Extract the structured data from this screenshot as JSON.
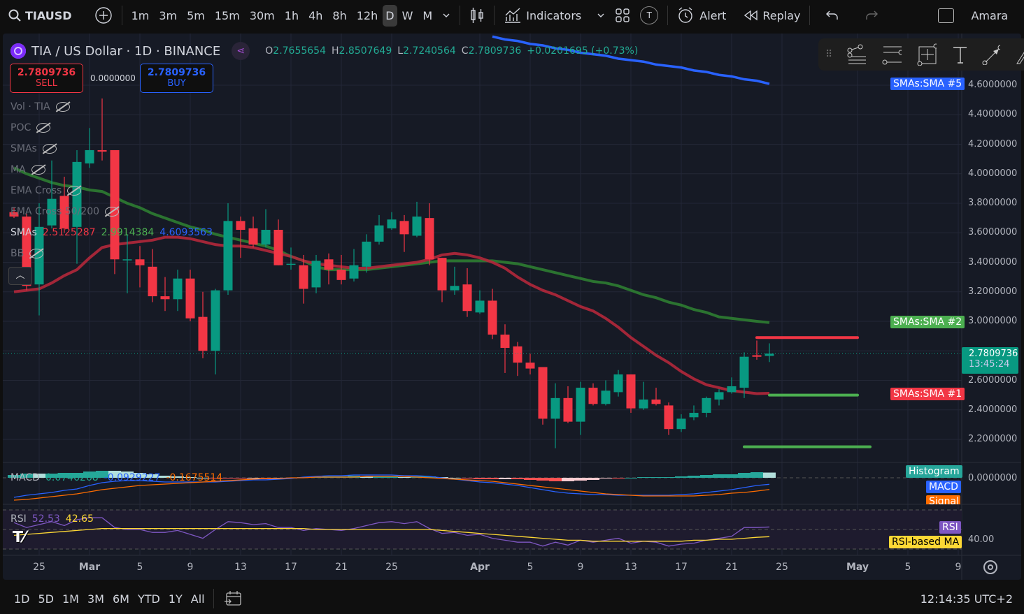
{
  "topbar": {
    "symbol": "TIAUSD",
    "intervals": [
      "1m",
      "3m",
      "5m",
      "15m",
      "30m",
      "1h",
      "4h",
      "8h",
      "12h",
      "D",
      "W",
      "M"
    ],
    "active_interval": "D",
    "indicators": "Indicators",
    "alert": "Alert",
    "replay": "Replay",
    "user": "Amara",
    "t_badge": "T"
  },
  "header": {
    "title": "TIA / US Dollar · 1D · BINANCE",
    "o_label": "O",
    "o": "2.7655654",
    "h_label": "H",
    "h": "2.8507649",
    "l_label": "L",
    "l": "2.7240564",
    "c_label": "C",
    "c": "2.7809736",
    "change": "+0.0201695 (+0.73%)"
  },
  "trade": {
    "sell_price": "2.7809736",
    "sell_label": "SELL",
    "spread": "0.0000000",
    "buy_price": "2.7809736",
    "buy_label": "BUY"
  },
  "legend": [
    {
      "name": "Vol · TIA"
    },
    {
      "name": "POC"
    },
    {
      "name": "SMAs"
    },
    {
      "name": "MA"
    },
    {
      "name": "EMA Cross"
    },
    {
      "name": "EMA Cross 50/200"
    }
  ],
  "smas_legend": {
    "name": "SMAs",
    "v1": "2.5125287",
    "v2": "2.9914384",
    "v3": "4.6093563"
  },
  "bb_legend": "BB",
  "macd_legend": {
    "name": "MACD",
    "hist": "0.0746268",
    "macd": "-0.0929227",
    "signal": "-0.1675514"
  },
  "rsi_legend": {
    "name": "RSI",
    "rsi": "52.53",
    "ma": "42.65"
  },
  "price_axis": {
    "labels": [
      "4.6000000",
      "4.4000000",
      "4.2000000",
      "4.0000000",
      "3.8000000",
      "3.6000000",
      "3.4000000",
      "3.2000000",
      "3.0000000",
      "2.6000000",
      "2.4000000",
      "2.2000000"
    ],
    "last_price": "2.7809736",
    "countdown": "13:45:24",
    "sma5": "SMAs:SMA #5",
    "sma2": "SMAs:SMA #2",
    "sma1": "SMAs:SMA #1",
    "macd_zero": "0.0000000",
    "hist_label": "Histogram",
    "macd_label": "MACD",
    "signal_label": "Signal",
    "rsi_label": "RSI",
    "rsi_ma_label": "RSI-based MA",
    "rsi_axis": "40.00"
  },
  "time_axis": [
    {
      "label": "25",
      "day": 2
    },
    {
      "label": "Mar",
      "day": 6
    },
    {
      "label": "5",
      "day": 10
    },
    {
      "label": "9",
      "day": 14
    },
    {
      "label": "13",
      "day": 18
    },
    {
      "label": "17",
      "day": 22
    },
    {
      "label": "21",
      "day": 26
    },
    {
      "label": "25",
      "day": 30
    },
    {
      "label": "Apr",
      "day": 37
    },
    {
      "label": "5",
      "day": 41
    },
    {
      "label": "9",
      "day": 45
    },
    {
      "label": "13",
      "day": 49
    },
    {
      "label": "17",
      "day": 53
    },
    {
      "label": "21",
      "day": 57
    },
    {
      "label": "25",
      "day": 61
    },
    {
      "label": "May",
      "day": 67
    },
    {
      "label": "5",
      "day": 71
    },
    {
      "label": "9",
      "day": 75
    }
  ],
  "bottombar": {
    "ranges": [
      "1D",
      "5D",
      "1M",
      "3M",
      "6M",
      "YTD",
      "1Y",
      "All"
    ],
    "clock": "12:14:35 UTC+2"
  },
  "colors": {
    "up": "#089981",
    "down": "#f23645",
    "sma1": "#b2283b",
    "sma2": "#2e7d32",
    "sma5": "#2962ff",
    "macd": "#2962ff",
    "signal": "#ff6d00",
    "rsi": "#7e57c2",
    "rsi_ma": "#fdd835"
  },
  "chart_data": {
    "type": "candlestick",
    "ylim": [
      2.1,
      4.7
    ],
    "ohlc": [
      [
        3.74,
        3.77,
        3.7,
        3.71
      ],
      [
        3.71,
        3.73,
        3.21,
        3.24
      ],
      [
        3.25,
        3.8,
        3.04,
        3.64
      ],
      [
        3.65,
        4.09,
        3.63,
        3.83
      ],
      [
        3.85,
        3.98,
        3.6,
        3.63
      ],
      [
        3.64,
        4.16,
        3.39,
        4.08
      ],
      [
        4.07,
        4.31,
        4.04,
        4.16
      ],
      [
        4.16,
        4.51,
        4.09,
        4.15
      ],
      [
        4.16,
        4.16,
        3.32,
        3.42
      ],
      [
        3.42,
        3.59,
        3.19,
        3.42
      ],
      [
        3.42,
        3.51,
        3.23,
        3.38
      ],
      [
        3.37,
        3.49,
        3.13,
        3.17
      ],
      [
        3.17,
        3.3,
        3.07,
        3.15
      ],
      [
        3.15,
        3.35,
        3.07,
        3.29
      ],
      [
        3.29,
        3.35,
        3.0,
        3.02
      ],
      [
        3.03,
        3.2,
        2.75,
        2.8
      ],
      [
        2.8,
        3.22,
        2.64,
        3.21
      ],
      [
        3.21,
        3.8,
        3.18,
        3.68
      ],
      [
        3.68,
        3.71,
        3.43,
        3.62
      ],
      [
        3.63,
        3.71,
        3.5,
        3.52
      ],
      [
        3.52,
        3.76,
        3.5,
        3.62
      ],
      [
        3.62,
        3.69,
        3.38,
        3.38
      ],
      [
        3.39,
        3.5,
        3.35,
        3.39
      ],
      [
        3.38,
        3.45,
        3.12,
        3.22
      ],
      [
        3.23,
        3.45,
        3.19,
        3.41
      ],
      [
        3.42,
        3.46,
        3.25,
        3.35
      ],
      [
        3.35,
        3.45,
        3.25,
        3.28
      ],
      [
        3.29,
        3.49,
        3.27,
        3.38
      ],
      [
        3.37,
        3.59,
        3.33,
        3.54
      ],
      [
        3.54,
        3.72,
        3.52,
        3.65
      ],
      [
        3.63,
        3.74,
        3.62,
        3.69
      ],
      [
        3.68,
        3.72,
        3.47,
        3.59
      ],
      [
        3.58,
        3.81,
        3.57,
        3.71
      ],
      [
        3.7,
        3.8,
        3.38,
        3.42
      ],
      [
        3.43,
        3.43,
        3.13,
        3.21
      ],
      [
        3.21,
        3.37,
        3.18,
        3.24
      ],
      [
        3.25,
        3.36,
        3.03,
        3.07
      ],
      [
        3.06,
        3.21,
        3.05,
        3.14
      ],
      [
        3.14,
        3.22,
        2.88,
        2.91
      ],
      [
        2.91,
        2.98,
        2.65,
        2.82
      ],
      [
        2.83,
        2.86,
        2.63,
        2.72
      ],
      [
        2.72,
        2.78,
        2.64,
        2.68
      ],
      [
        2.69,
        2.69,
        2.3,
        2.34
      ],
      [
        2.34,
        2.58,
        2.14,
        2.48
      ],
      [
        2.48,
        2.56,
        2.31,
        2.32
      ],
      [
        2.32,
        2.59,
        2.23,
        2.55
      ],
      [
        2.55,
        2.58,
        2.43,
        2.44
      ],
      [
        2.44,
        2.6,
        2.43,
        2.53
      ],
      [
        2.52,
        2.67,
        2.49,
        2.64
      ],
      [
        2.64,
        2.64,
        2.38,
        2.41
      ],
      [
        2.41,
        2.59,
        2.4,
        2.47
      ],
      [
        2.47,
        2.55,
        2.43,
        2.44
      ],
      [
        2.43,
        2.45,
        2.23,
        2.27
      ],
      [
        2.27,
        2.37,
        2.25,
        2.34
      ],
      [
        2.35,
        2.43,
        2.33,
        2.38
      ],
      [
        2.38,
        2.49,
        2.35,
        2.48
      ],
      [
        2.47,
        2.54,
        2.43,
        2.52
      ],
      [
        2.52,
        2.62,
        2.51,
        2.56
      ],
      [
        2.55,
        2.79,
        2.48,
        2.76
      ],
      [
        2.77,
        2.87,
        2.74,
        2.76
      ],
      [
        2.7655654,
        2.8507649,
        2.7240564,
        2.7809736
      ]
    ],
    "sma1": [
      3.2,
      3.21,
      3.22,
      3.26,
      3.31,
      3.35,
      3.43,
      3.5,
      3.52,
      3.53,
      3.54,
      3.55,
      3.57,
      3.57,
      3.56,
      3.54,
      3.52,
      3.51,
      3.51,
      3.5,
      3.48,
      3.46,
      3.44,
      3.41,
      3.39,
      3.38,
      3.37,
      3.36,
      3.36,
      3.37,
      3.38,
      3.39,
      3.4,
      3.42,
      3.45,
      3.46,
      3.45,
      3.43,
      3.4,
      3.36,
      3.3,
      3.25,
      3.21,
      3.18,
      3.14,
      3.1,
      3.07,
      3.02,
      2.96,
      2.89,
      2.83,
      2.77,
      2.72,
      2.66,
      2.61,
      2.57,
      2.55,
      2.53,
      2.52,
      2.51,
      2.5125287
    ],
    "sma2": [
      4.04,
      4.0,
      3.97,
      3.94,
      3.92,
      3.91,
      3.89,
      3.88,
      3.84,
      3.8,
      3.77,
      3.73,
      3.7,
      3.67,
      3.64,
      3.62,
      3.59,
      3.57,
      3.55,
      3.53,
      3.51,
      3.48,
      3.44,
      3.41,
      3.37,
      3.35,
      3.35,
      3.35,
      3.35,
      3.36,
      3.37,
      3.38,
      3.39,
      3.4,
      3.41,
      3.41,
      3.41,
      3.41,
      3.41,
      3.4,
      3.39,
      3.37,
      3.35,
      3.33,
      3.31,
      3.29,
      3.27,
      3.26,
      3.24,
      3.21,
      3.18,
      3.16,
      3.13,
      3.11,
      3.08,
      3.06,
      3.03,
      3.02,
      3.01,
      3.0,
      2.9914384
    ],
    "sma5_start": 38,
    "sma5": [
      4.93,
      4.91,
      4.9,
      4.88,
      4.87,
      4.85,
      4.84,
      4.82,
      4.81,
      4.8,
      4.78,
      4.77,
      4.76,
      4.74,
      4.73,
      4.72,
      4.7,
      4.69,
      4.67,
      4.66,
      4.64,
      4.63,
      4.6093563
    ],
    "levels": [
      {
        "price": 2.89,
        "color": "#f23645",
        "from": 59,
        "to": 67
      },
      {
        "price": 2.5,
        "color": "#4caf50",
        "from": 60,
        "to": 67
      },
      {
        "price": 2.15,
        "color": "#4caf50",
        "from": 58,
        "to": 68
      }
    ],
    "macd": [
      -0.28,
      -0.25,
      -0.23,
      -0.21,
      -0.18,
      -0.16,
      -0.11,
      -0.07,
      -0.05,
      -0.04,
      -0.04,
      -0.05,
      -0.06,
      -0.06,
      -0.06,
      -0.06,
      -0.06,
      -0.05,
      -0.04,
      -0.03,
      -0.03,
      -0.02,
      -0.01,
      0.01,
      0.02,
      0.03,
      0.03,
      0.04,
      0.04,
      0.04,
      0.04,
      0.03,
      0.03,
      0.02,
      0.0,
      -0.02,
      -0.04,
      -0.06,
      -0.07,
      -0.09,
      -0.11,
      -0.14,
      -0.17,
      -0.2,
      -0.22,
      -0.23,
      -0.24,
      -0.24,
      -0.25,
      -0.25,
      -0.25,
      -0.25,
      -0.25,
      -0.24,
      -0.23,
      -0.21,
      -0.19,
      -0.17,
      -0.14,
      -0.11,
      -0.0929227
    ],
    "signal": [
      -0.32,
      -0.31,
      -0.29,
      -0.27,
      -0.25,
      -0.23,
      -0.2,
      -0.17,
      -0.15,
      -0.13,
      -0.11,
      -0.1,
      -0.09,
      -0.08,
      -0.07,
      -0.06,
      -0.05,
      -0.04,
      -0.03,
      -0.02,
      -0.01,
      -0.01,
      0.0,
      0.0,
      0.01,
      0.01,
      0.01,
      0.01,
      0.02,
      0.02,
      0.02,
      0.02,
      0.01,
      0.0,
      -0.01,
      -0.02,
      -0.03,
      -0.04,
      -0.05,
      -0.07,
      -0.09,
      -0.11,
      -0.13,
      -0.15,
      -0.17,
      -0.19,
      -0.21,
      -0.23,
      -0.24,
      -0.25,
      -0.26,
      -0.26,
      -0.26,
      -0.26,
      -0.26,
      -0.25,
      -0.24,
      -0.22,
      -0.21,
      -0.19,
      -0.1675514
    ],
    "rsi": [
      57,
      52,
      55,
      58,
      54,
      60,
      62,
      62,
      52,
      50,
      50,
      47,
      47,
      49,
      45,
      41,
      50,
      58,
      57,
      55,
      56,
      52,
      52,
      49,
      51,
      50,
      49,
      51,
      54,
      57,
      58,
      56,
      58,
      51,
      46,
      47,
      44,
      45,
      41,
      39,
      37,
      37,
      33,
      37,
      34,
      39,
      37,
      39,
      41,
      36,
      38,
      37,
      33,
      35,
      36,
      39,
      41,
      43,
      52,
      52,
      52.53
    ],
    "rsi_ma": [
      44,
      45,
      46,
      47,
      48,
      49,
      50,
      51,
      51,
      51,
      51,
      51,
      51,
      51,
      51,
      51,
      51,
      51,
      51,
      51,
      51,
      51,
      51,
      51,
      50,
      50,
      50,
      50,
      50,
      50,
      50,
      50,
      50,
      50,
      49,
      48,
      47,
      46,
      45,
      44,
      43,
      42,
      41,
      40,
      39,
      39,
      38,
      38,
      38,
      38,
      38,
      38,
      38,
      38,
      39,
      39,
      40,
      40,
      41,
      42,
      42.65
    ]
  }
}
